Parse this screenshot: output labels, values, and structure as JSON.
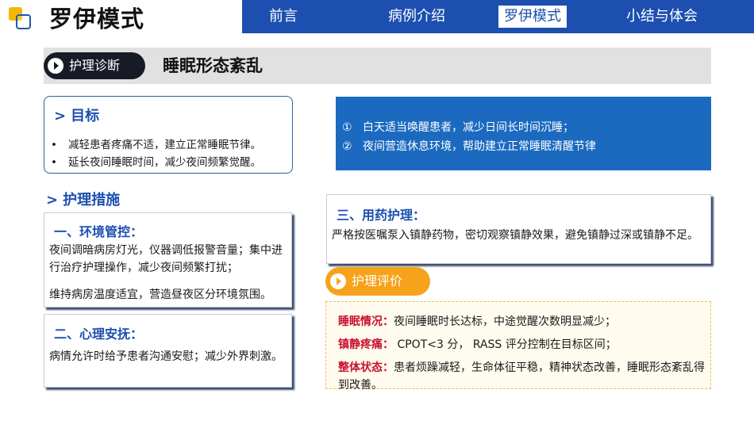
{
  "header": {
    "brand_title": "罗伊模式",
    "nav": [
      {
        "label": "前言",
        "active": false
      },
      {
        "label": "病例介绍",
        "active": false
      },
      {
        "label": "罗伊模式",
        "active": true
      },
      {
        "label": "小结与体会",
        "active": false
      }
    ]
  },
  "section": {
    "pill_label": "护理诊断",
    "title": "睡眠形态紊乱"
  },
  "goal": {
    "heading": "目标",
    "bullet": "•",
    "items": [
      "减轻患者疼痛不适，建立正常睡眠节律。",
      "延长夜间睡眠时间，减少夜间频繁觉醒。"
    ]
  },
  "info_box": {
    "items": [
      {
        "num": "①",
        "text": "白天适当唤醒患者，减少日间长时间沉睡；"
      },
      {
        "num": "②",
        "text": "夜间营造休息环境，帮助建立正常睡眠清醒节律"
      }
    ]
  },
  "measures": {
    "heading": "护理措施",
    "environment": {
      "title": "一、环境管控：",
      "para1": "夜间调暗病房灯光，仪器调低报警音量；集中进行治疗护理操作，减少夜间频繁打扰；",
      "para2": "维持病房温度适宜，营造昼夜区分环境氛围。"
    },
    "psychological": {
      "title": "二、心理安抚：",
      "para1": "病情允许时给予患者沟通安慰；减少外界刺激。"
    },
    "medication": {
      "title": "三、用药护理：",
      "para1": "严格按医嘱泵入镇静药物，密切观察镇静效果，避免镇静过深或镇静不足。"
    }
  },
  "evaluation": {
    "pill_label": "护理评价",
    "rows": [
      {
        "label": "睡眠情况：",
        "text": "夜间睡眠时长达标，中途觉醒次数明显减少；"
      },
      {
        "label": "镇静疼痛：",
        "text": " CPOT<3 分， RASS 评分控制在目标区间；"
      },
      {
        "label": "整体状态：",
        "text": "患者烦躁减轻，生命体征平稳，精神状态改善，睡眠形态紊乱得到改善。"
      }
    ]
  },
  "colors": {
    "brand_blue": "#1c4fb0",
    "info_blue": "#1b6ac0",
    "accent_orange": "#f7a21b",
    "label_red": "#c8102e"
  }
}
